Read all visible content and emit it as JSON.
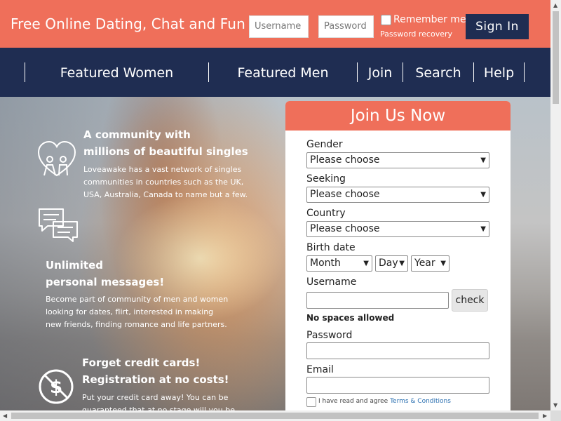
{
  "header": {
    "site_title": "Free Online Dating, Chat and Fun",
    "username_placeholder": "Username",
    "password_placeholder": "Password",
    "remember_label": "Remember me",
    "password_recovery": "Password recovery",
    "signin_label": "Sign In"
  },
  "nav": {
    "items": [
      "Featured Women",
      "Featured Men",
      "Join",
      "Search",
      "Help"
    ]
  },
  "features": [
    {
      "icon": "hearts-couple-icon",
      "title_line1": "A community with",
      "title_line2": "millions of beautiful singles",
      "text_line1": "Loveawake has a vast network of singles",
      "text_line2": "communities in countries such as the UK,",
      "text_line3": "USA, Australia, Canada to name but a few."
    },
    {
      "icon": "chat-bubbles-icon",
      "title_line1": "Unlimited",
      "title_line2": "personal messages!",
      "text_line1": "Become part of community of men and women",
      "text_line2": "looking for dates, flirt, interested in making",
      "text_line3": "new friends, finding romance and life partners."
    },
    {
      "icon": "no-dollar-icon",
      "title_line1": "Forget credit cards!",
      "title_line2": "Registration at no costs!",
      "text_line1": "Put your credit card away! You can be",
      "text_line2": "guaranteed that at no stage will you be"
    }
  ],
  "join_form": {
    "title": "Join Us Now",
    "gender_label": "Gender",
    "gender_value": "Please choose",
    "seeking_label": "Seeking",
    "seeking_value": "Please choose",
    "country_label": "Country",
    "country_value": "Please choose",
    "birth_label": "Birth date",
    "month_value": "Month",
    "day_value": "Day",
    "year_value": "Year",
    "username_label": "Username",
    "check_label": "check",
    "no_spaces": "No spaces allowed",
    "password_label": "Password",
    "email_label": "Email",
    "terms_text": "I have read and agree",
    "terms_link": "Terms & Conditions"
  },
  "colors": {
    "accent": "#ef6f5a",
    "navy": "#1f2d52"
  }
}
